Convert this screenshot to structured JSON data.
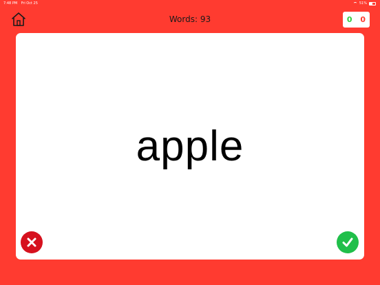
{
  "status_bar": {
    "time": "7:48 PM",
    "date": "Fri Oct 25",
    "battery": "51%",
    "battery_level": 0.51,
    "wifi_icon": "wifi-icon",
    "battery_icon": "battery-icon"
  },
  "header": {
    "home_icon": "home-icon",
    "title": "Words: 93"
  },
  "score": {
    "correct": "0",
    "wrong": "0",
    "correct_color": "#2ecc40",
    "wrong_color": "#ff3b30"
  },
  "card": {
    "word": "apple",
    "wrong_icon": "close-icon",
    "correct_icon": "checkmark-icon"
  },
  "colors": {
    "background": "#ff3b30",
    "card": "#ffffff",
    "wrong_button": "#d6111e",
    "correct_button": "#20bf4a"
  }
}
